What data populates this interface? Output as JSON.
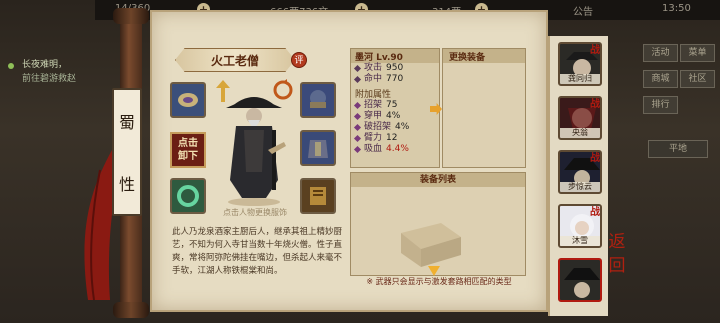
{
  "topbar": {
    "stamina": "14/360",
    "silver": "666两736文",
    "gold": "314两",
    "notice": "公告",
    "clock": "13:50"
  },
  "left_panel": {
    "line1": "长夜难明，",
    "line2": "前往碧游救赵"
  },
  "hero": {
    "name": "火工老僧",
    "comment_label": "评",
    "sect": [
      "蜀",
      "性"
    ],
    "unequip_label": [
      "点击",
      "卸下"
    ],
    "portrait_tip": "点击人物更换服饰",
    "bio": "此人乃龙泉酒家主厨后人，继承其祖上精妙厨艺，不知为何入寺甘当数十年烧火僧。性子直爽，常将阿弥陀佛挂在嘴边，但杀起人来毫不手软，江湖人称铁棍棠和尚。"
  },
  "equipped": {
    "title": "墨河 Lv.90",
    "stats": [
      {
        "label": "攻击",
        "value": "950"
      },
      {
        "label": "命中",
        "value": "770"
      }
    ],
    "extra_header": "附加属性",
    "extra": [
      {
        "label": "招架",
        "value": "75"
      },
      {
        "label": "穿甲",
        "value": "4%"
      },
      {
        "label": "破招架",
        "value": "4%"
      },
      {
        "label": "臂力",
        "value": "12"
      },
      {
        "label": "吸血",
        "value": "4.4%"
      }
    ]
  },
  "replace_panel": {
    "title": "更换装备"
  },
  "equip_list": {
    "title": "装备列表",
    "note": "※ 武器只会显示与激发套路相匹配的类型"
  },
  "heroes": [
    {
      "name": "龚同归"
    },
    {
      "name": "央翁"
    },
    {
      "name": "步惊云"
    },
    {
      "name": "沐雪"
    },
    {
      "name": ""
    }
  ],
  "right_menu": {
    "items": [
      "活动",
      "菜单",
      "商城",
      "社区",
      "排行"
    ],
    "flat": "平地"
  },
  "back_label": [
    "返",
    "回"
  ],
  "colors": {
    "accent": "#b23a1e",
    "paper": "#e6dcc2"
  }
}
